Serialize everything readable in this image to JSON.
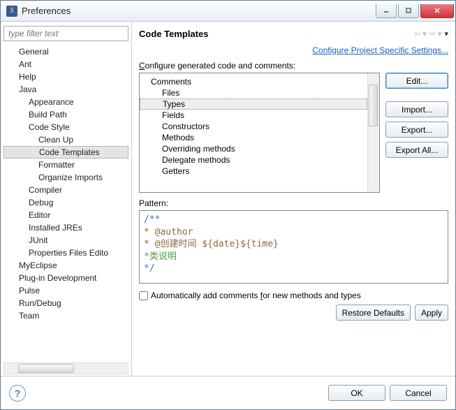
{
  "window": {
    "title": "Preferences"
  },
  "sidebar": {
    "filter_placeholder": "type filter text",
    "items": [
      {
        "label": "General",
        "level": 1
      },
      {
        "label": "Ant",
        "level": 1
      },
      {
        "label": "Help",
        "level": 1
      },
      {
        "label": "Java",
        "level": 1
      },
      {
        "label": "Appearance",
        "level": 2
      },
      {
        "label": "Build Path",
        "level": 2
      },
      {
        "label": "Code Style",
        "level": 2
      },
      {
        "label": "Clean Up",
        "level": 3
      },
      {
        "label": "Code Templates",
        "level": 3,
        "selected": true
      },
      {
        "label": "Formatter",
        "level": 3
      },
      {
        "label": "Organize Imports",
        "level": 3
      },
      {
        "label": "Compiler",
        "level": 2
      },
      {
        "label": "Debug",
        "level": 2
      },
      {
        "label": "Editor",
        "level": 2
      },
      {
        "label": "Installed JREs",
        "level": 2
      },
      {
        "label": "JUnit",
        "level": 2
      },
      {
        "label": "Properties Files Edito",
        "level": 2
      },
      {
        "label": "MyEclipse",
        "level": 1
      },
      {
        "label": "Plug-in Development",
        "level": 1
      },
      {
        "label": "Pulse",
        "level": 1
      },
      {
        "label": "Run/Debug",
        "level": 1
      },
      {
        "label": "Team",
        "level": 1
      }
    ]
  },
  "content": {
    "title": "Code Templates",
    "config_link": "Configure Project Specific Settings...",
    "section_label_pre": "C",
    "section_label_rest": "onfigure generated code and comments:",
    "list": [
      {
        "label": "Comments",
        "level": 1
      },
      {
        "label": "Files",
        "level": 2
      },
      {
        "label": "Types",
        "level": 2,
        "selected": true
      },
      {
        "label": "Fields",
        "level": 2
      },
      {
        "label": "Constructors",
        "level": 2
      },
      {
        "label": "Methods",
        "level": 2
      },
      {
        "label": "Overriding methods",
        "level": 2
      },
      {
        "label": "Delegate methods",
        "level": 2
      },
      {
        "label": "Getters",
        "level": 2
      }
    ],
    "buttons": {
      "edit": "Edit...",
      "import": "Import...",
      "export": "Export...",
      "export_all": "Export All..."
    },
    "pattern_label": "Pattern:",
    "pattern_lines": [
      {
        "text": "/**",
        "cls": ""
      },
      {
        "text": " * @author",
        "cls": "kw"
      },
      {
        "text": " * @创建时间 ${date}${time}",
        "cls": "kw"
      },
      {
        "text": " *类说明",
        "cls": "gr"
      },
      {
        "text": " */",
        "cls": ""
      }
    ],
    "checkbox_label_pre": "Automatically add comments ",
    "checkbox_label_u": "f",
    "checkbox_label_post": "or new methods and types",
    "restore": "Restore Defaults",
    "apply": "Apply"
  },
  "footer": {
    "ok": "OK",
    "cancel": "Cancel"
  }
}
